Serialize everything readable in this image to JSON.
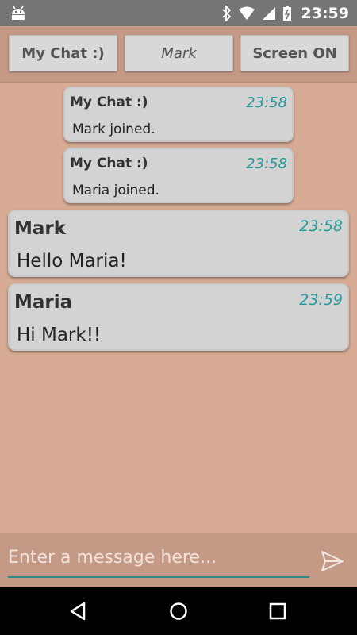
{
  "status_bar": {
    "time": "23:59",
    "icons": [
      "android-icon",
      "bluetooth-icon",
      "wifi-icon",
      "signal-icon",
      "battery-icon"
    ]
  },
  "toolbar": {
    "left_button": "My Chat :)",
    "middle_button": "Mark",
    "right_button": "Screen ON"
  },
  "messages": [
    {
      "sender": "My Chat :)",
      "time": "23:58",
      "text": "Mark joined."
    },
    {
      "sender": "My Chat :)",
      "time": "23:58",
      "text": "Maria joined."
    },
    {
      "sender": "Mark",
      "time": "23:58",
      "text": "Hello Maria!"
    },
    {
      "sender": "Maria",
      "time": "23:59",
      "text": "Hi Mark!!"
    }
  ],
  "composer": {
    "placeholder": "Enter a message here...",
    "value": "",
    "send_icon": "send-icon"
  },
  "nav_bar": {
    "icons": [
      "back-icon",
      "home-icon",
      "recents-icon"
    ]
  },
  "colors": {
    "background": "#d7ab94",
    "toolbar": "#c49a86",
    "bubble": "#d3d3d3",
    "timestamp": "#239a9a",
    "input_underline": "#2e8a82"
  }
}
